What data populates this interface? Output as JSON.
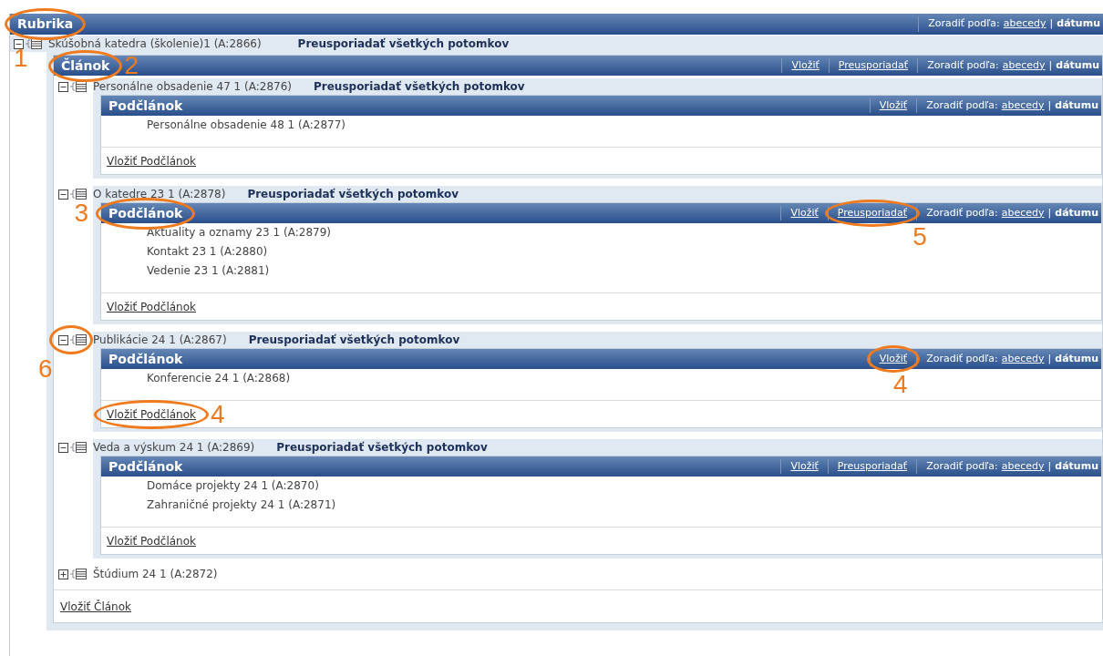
{
  "root": {
    "title": "Rubrika",
    "callout": "1",
    "sort": {
      "label": "Zoradiť podľa:",
      "separator": "|",
      "options": [
        {
          "label": "abecedy",
          "selected": false
        },
        {
          "label": "dátumu",
          "selected": true
        }
      ]
    },
    "node": {
      "label": "Skúšobná katedra (školenie)1 (A:2866)",
      "expanded": true,
      "reorder": "Preusporiadať všetkých potomkov",
      "section": {
        "title": "Článok",
        "callout": "2",
        "actions": [
          {
            "label": "Vložiť"
          },
          {
            "label": "Preusporiadať"
          }
        ],
        "sort": {
          "label": "Zoradiť podľa:",
          "separator": "|",
          "options": [
            {
              "label": "abecedy",
              "selected": false
            },
            {
              "label": "dátumu",
              "selected": true
            }
          ]
        },
        "footer": "Vložiť Článok",
        "nodes": [
          {
            "label": "Personálne obsadenie 47 1 (A:2876)",
            "expanded": true,
            "reorder": "Preusporiadať všetkých potomkov",
            "section": {
              "title": "Podčlánok",
              "actions": [
                {
                  "label": "Vložiť"
                }
              ],
              "sort": {
                "label": "Zoradiť podľa:",
                "separator": "|",
                "options": [
                  {
                    "label": "abecedy",
                    "selected": false
                  },
                  {
                    "label": "dátumu",
                    "selected": true
                  }
                ]
              },
              "items": [
                "Personálne obsadenie 48 1 (A:2877)"
              ],
              "footer": "Vložiť Podčlánok"
            }
          },
          {
            "label": "O katedre 23 1 (A:2878)",
            "expanded": true,
            "reorder": "Preusporiadať všetkých potomkov",
            "section": {
              "title": "Podčlánok",
              "callout": "3",
              "actions": [
                {
                  "label": "Vložiť"
                },
                {
                  "label": "Preusporiadať",
                  "callout": "5"
                }
              ],
              "sort": {
                "label": "Zoradiť podľa:",
                "separator": "|",
                "options": [
                  {
                    "label": "abecedy",
                    "selected": false
                  },
                  {
                    "label": "dátumu",
                    "selected": true
                  }
                ]
              },
              "items": [
                "Aktuality a oznamy 23 1 (A:2879)",
                "Kontakt 23 1 (A:2880)",
                "Vedenie 23 1 (A:2881)"
              ],
              "footer": "Vložiť Podčlánok"
            }
          },
          {
            "label": "Publikácie 24 1 (A:2867)",
            "expanded": true,
            "icon_callout": "6",
            "reorder": "Preusporiadať všetkých potomkov",
            "section": {
              "title": "Podčlánok",
              "actions": [
                {
                  "label": "Vložiť",
                  "callout": "4"
                }
              ],
              "sort": {
                "label": "Zoradiť podľa:",
                "separator": "|",
                "options": [
                  {
                    "label": "abecedy",
                    "selected": false
                  },
                  {
                    "label": "dátumu",
                    "selected": true
                  }
                ]
              },
              "items": [
                "Konferencie 24 1 (A:2868)"
              ],
              "footer": "Vložiť Podčlánok",
              "footer_callout": "4"
            }
          },
          {
            "label": "Veda a výskum 24 1 (A:2869)",
            "expanded": true,
            "reorder": "Preusporiadať všetkých potomkov",
            "section": {
              "title": "Podčlánok",
              "actions": [
                {
                  "label": "Vložiť"
                },
                {
                  "label": "Preusporiadať"
                }
              ],
              "sort": {
                "label": "Zoradiť podľa:",
                "separator": "|",
                "options": [
                  {
                    "label": "abecedy",
                    "selected": false
                  },
                  {
                    "label": "dátumu",
                    "selected": true
                  }
                ]
              },
              "items": [
                "Domáce projekty 24 1 (A:2870)",
                "Zahraničné projekty 24 1 (A:2871)"
              ],
              "footer": "Vložiť Podčlánok"
            }
          },
          {
            "label": "Štúdium 24 1 (A:2872)",
            "expanded": false
          }
        ]
      }
    }
  }
}
